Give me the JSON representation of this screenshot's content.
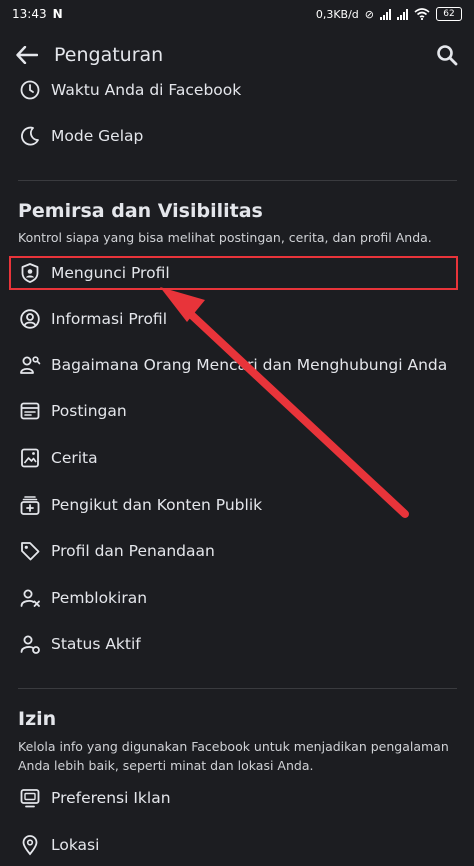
{
  "status_bar": {
    "time": "13:43",
    "notification_icon": "N",
    "network_speed": "0,3KB/d",
    "battery": "62"
  },
  "header": {
    "title": "Pengaturan"
  },
  "top_items": [
    {
      "label": "Waktu Anda di Facebook",
      "icon": "clock-icon"
    },
    {
      "label": "Mode Gelap",
      "icon": "moon-icon"
    }
  ],
  "audience_section": {
    "title": "Pemirsa dan Visibilitas",
    "description": "Kontrol siapa yang bisa melihat postingan, cerita, dan profil Anda.",
    "items": [
      {
        "label": "Mengunci Profil",
        "icon": "profile-lock-shield-icon"
      },
      {
        "label": "Informasi Profil",
        "icon": "user-circle-icon"
      },
      {
        "label": "Bagaimana Orang Mencari dan Menghubungi Anda",
        "icon": "user-search-icon"
      },
      {
        "label": "Postingan",
        "icon": "post-icon"
      },
      {
        "label": "Cerita",
        "icon": "story-icon"
      },
      {
        "label": "Pengikut dan Konten Publik",
        "icon": "followers-icon"
      },
      {
        "label": "Profil dan Penandaan",
        "icon": "tag-icon"
      },
      {
        "label": "Pemblokiran",
        "icon": "block-user-icon"
      },
      {
        "label": "Status Aktif",
        "icon": "active-status-icon"
      }
    ]
  },
  "permissions_section": {
    "title": "Izin",
    "description": "Kelola info yang digunakan Facebook untuk menjadikan pengalaman Anda lebih baik, seperti minat dan lokasi Anda.",
    "items": [
      {
        "label": "Preferensi Iklan",
        "icon": "ad-preferences-icon"
      },
      {
        "label": "Lokasi",
        "icon": "location-icon"
      }
    ]
  },
  "colors": {
    "background": "#1c1d21",
    "text": "#e4e6eb",
    "highlight": "#e8343a"
  }
}
